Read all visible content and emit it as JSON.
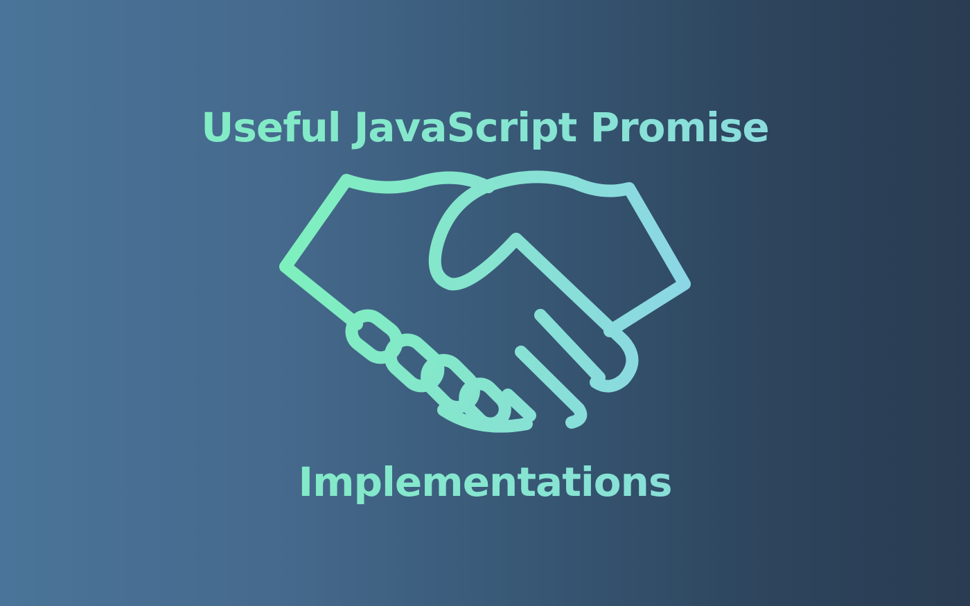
{
  "title_line1": "Useful JavaScript Promise",
  "title_line2": "Implementations",
  "icon": "handshake-icon",
  "colors": {
    "background_left": "#4a7499",
    "background_right": "#293c52",
    "accent_green": "#7ef0bd",
    "accent_cyan": "#8cd6e6"
  }
}
